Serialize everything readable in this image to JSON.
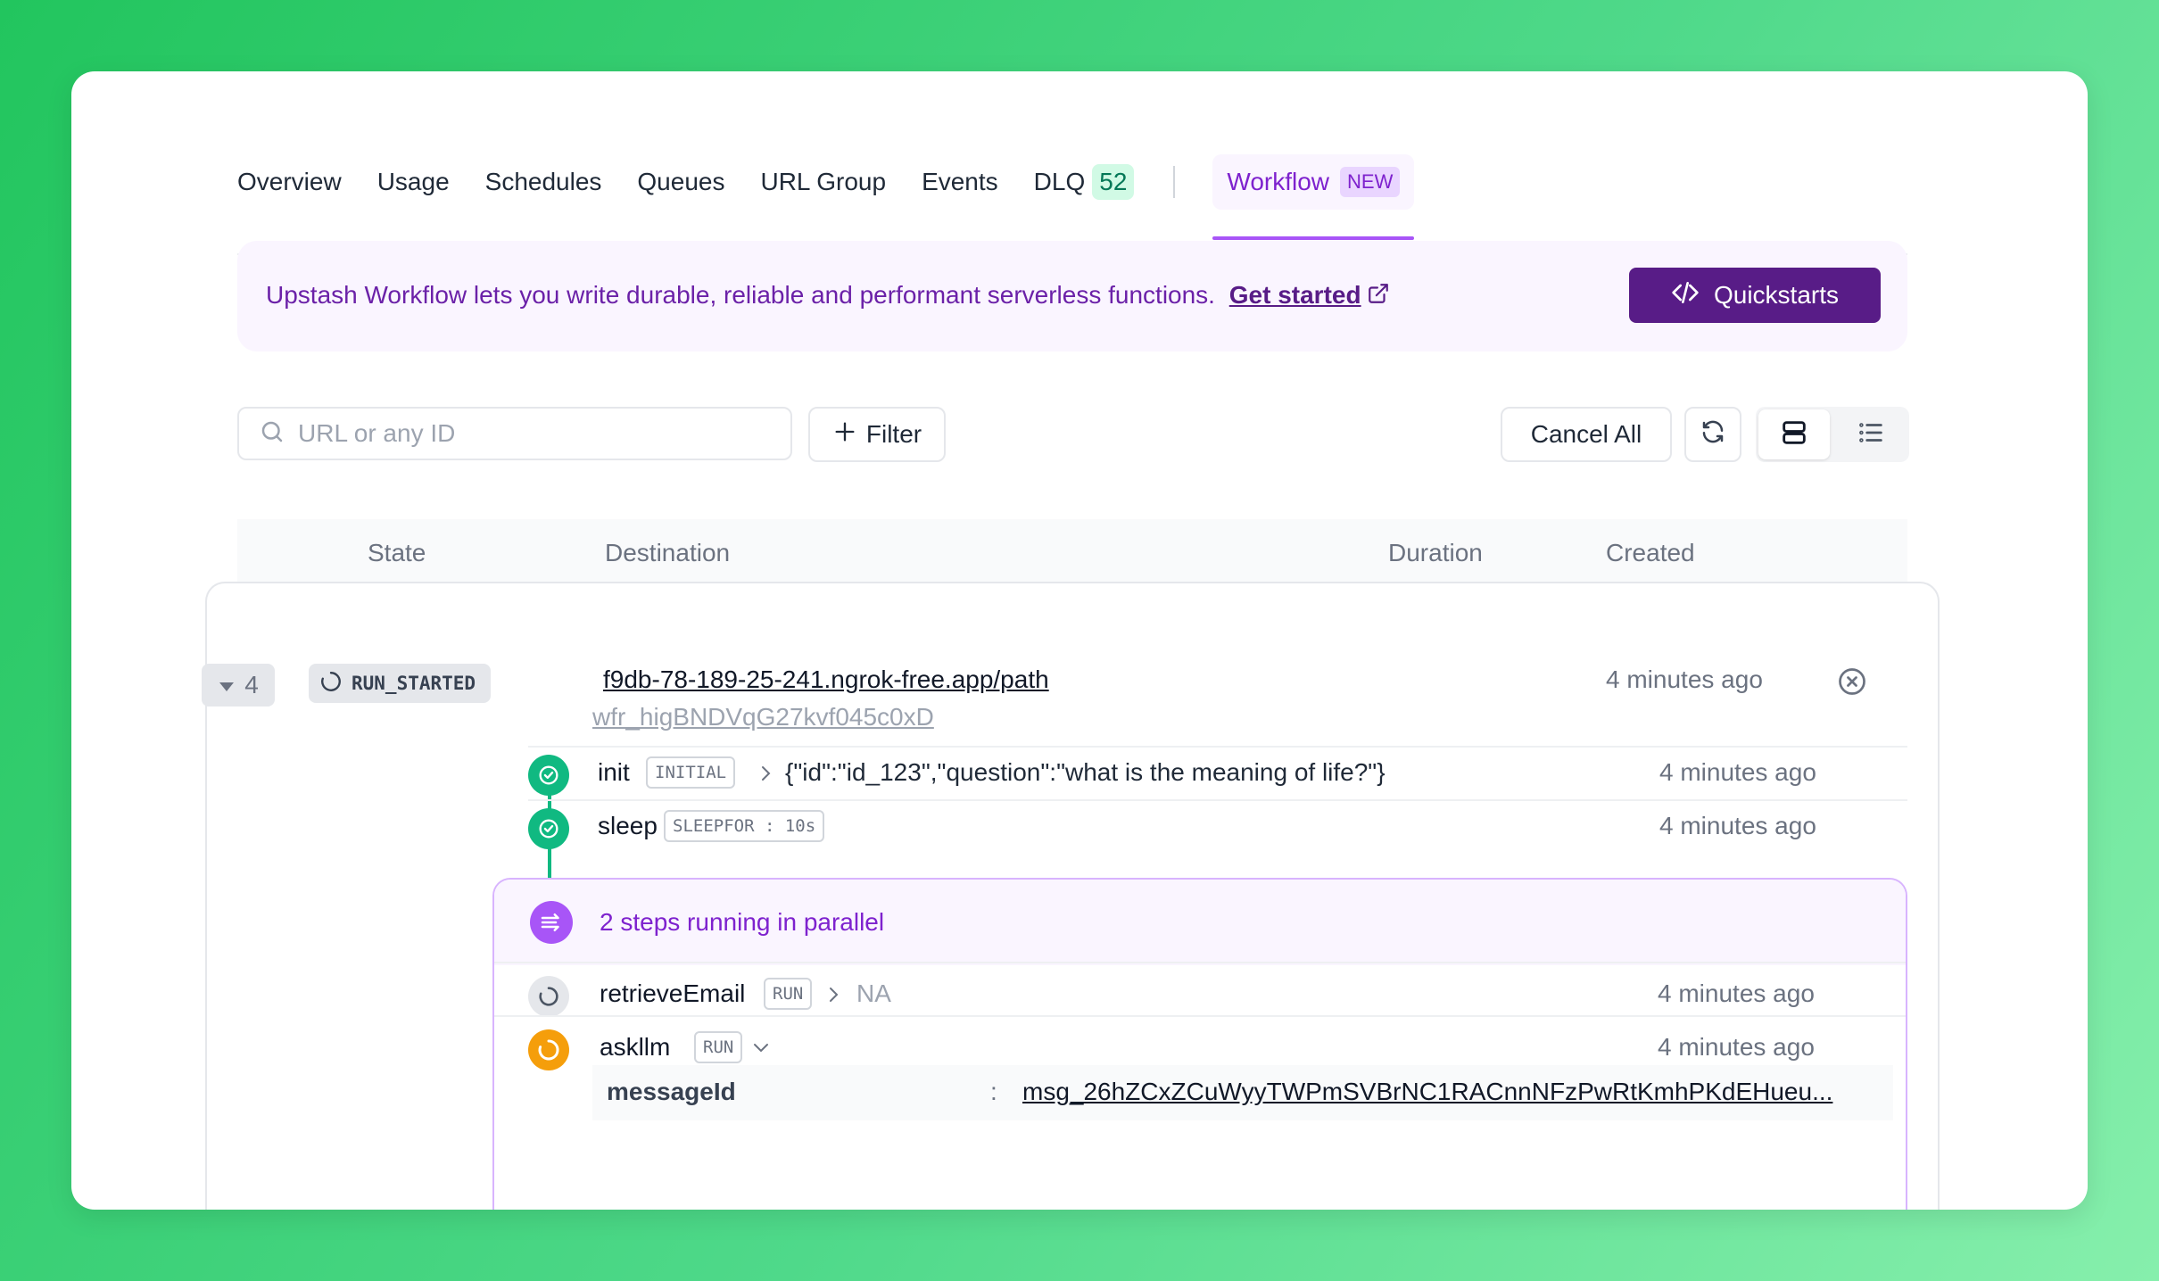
{
  "tabs": {
    "overview": "Overview",
    "usage": "Usage",
    "schedules": "Schedules",
    "queues": "Queues",
    "url_group": "URL Group",
    "events": "Events",
    "dlq": "DLQ",
    "dlq_count": "52",
    "workflow": "Workflow",
    "workflow_badge": "NEW",
    "active": "Workflow"
  },
  "banner": {
    "text": "Upstash Workflow lets you write durable, reliable and performant serverless functions.",
    "link": "Get started",
    "button": "Quickstarts"
  },
  "toolbar": {
    "search_placeholder": "URL or any ID",
    "search_value": "",
    "filter": "Filter",
    "cancel_all": "Cancel All",
    "view_mode": "expanded"
  },
  "table": {
    "headers": {
      "state": "State",
      "destination": "Destination",
      "duration": "Duration",
      "created": "Created"
    }
  },
  "run": {
    "step_count": "4",
    "state": "RUN_STARTED",
    "destination": "f9db-78-189-25-241.ngrok-free.app/path",
    "run_id": "wfr_higBNDVqG27kvf045c0xD",
    "created": "4 minutes ago",
    "steps": [
      {
        "name": "init",
        "type": "INITIAL",
        "payload": "{\"id\":\"id_123\",\"question\":\"what is the meaning of life?\"}",
        "time": "4 minutes ago"
      },
      {
        "name": "sleep",
        "type": "SLEEPFOR : 10s",
        "time": "4 minutes ago"
      }
    ],
    "parallel": {
      "label": "2 steps running in parallel",
      "steps": [
        {
          "name": "retrieveEmail",
          "type": "RUN",
          "payload": "NA",
          "time": "4 minutes ago"
        },
        {
          "name": "askllm",
          "type": "RUN",
          "time": "4 minutes ago",
          "details": {
            "key": "messageId",
            "colon": ":",
            "value": "msg_26hZCxZCuWyyTWPmSVBrNC1RACnnNFzPwRtKmhPKdEHueu..."
          }
        }
      ]
    }
  },
  "colors": {
    "accent": "#7e22ce",
    "accent_dark": "#581c87",
    "success": "#10b981",
    "warning": "#f59e0b",
    "background": "#22c55e"
  },
  "icons": {
    "search": "search-icon",
    "filter": "plus-icon",
    "refresh": "refresh-icon",
    "view_cards": "cards-view-icon",
    "view_list": "list-view-icon",
    "external": "external-link-icon",
    "code": "code-icon",
    "state": "spinner-icon",
    "cancel": "cancel-circle-icon",
    "step_done": "check-circle-icon",
    "parallel": "parallel-arrows-icon"
  }
}
